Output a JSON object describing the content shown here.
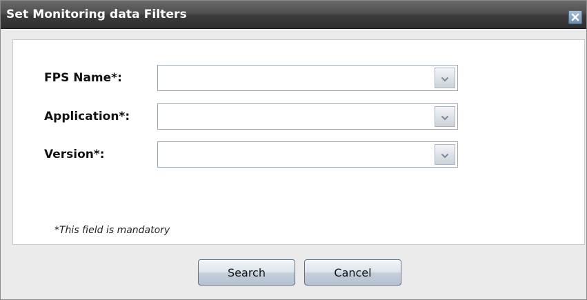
{
  "dialog": {
    "title": "Set Monitoring data Filters",
    "close_icon": "close-icon"
  },
  "form": {
    "fields": [
      {
        "label": "FPS Name*:",
        "value": "",
        "arrow_icon": "chevron-down-icon"
      },
      {
        "label": "Application*:",
        "value": "",
        "arrow_icon": "chevron-down-icon"
      },
      {
        "label": "Version*:",
        "value": "",
        "arrow_icon": "chevron-down-icon"
      }
    ],
    "mandatory_note": "*This field is mandatory"
  },
  "buttons": {
    "search_label": "Search",
    "cancel_label": "Cancel"
  },
  "colors": {
    "titlebar": "#3b3b3b",
    "title_text": "#ffffff",
    "button_border": "#5b6f86",
    "close_button": "#6f8eb0"
  }
}
